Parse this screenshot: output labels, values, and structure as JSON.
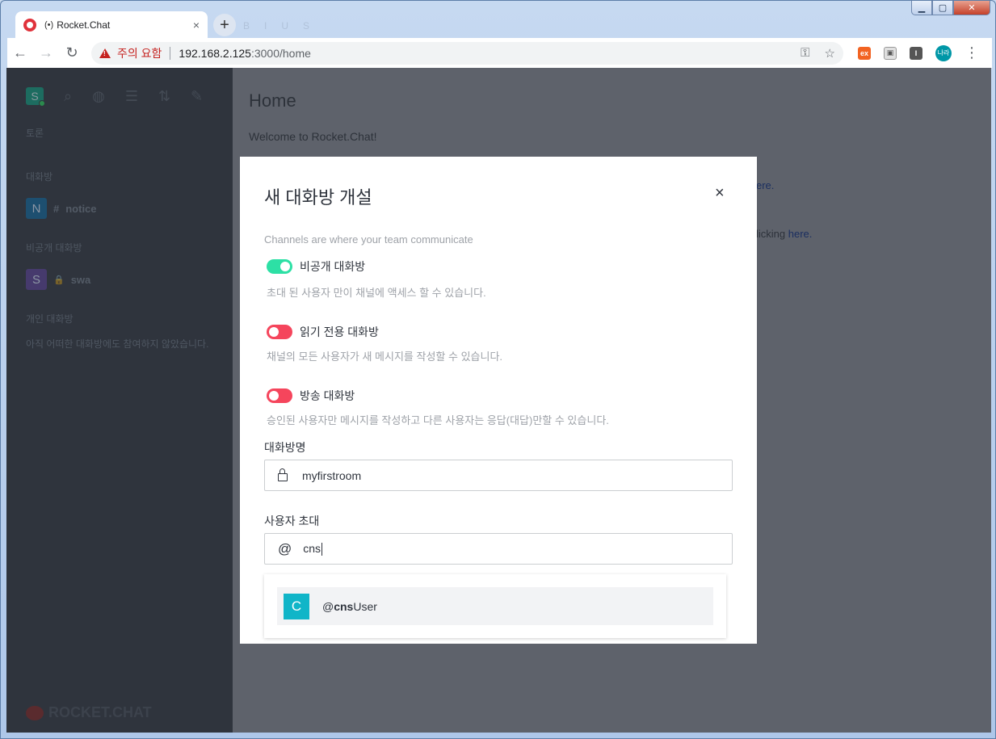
{
  "browser": {
    "tab_title": "Rocket.Chat",
    "tab_audio": "(•)",
    "tab_close": "×",
    "new_tab": "+",
    "security_warning": "주의 요함",
    "url_host": "192.168.2.125",
    "url_path": ":3000/home",
    "profile_initials": "나라",
    "ext_labels": [
      "ex",
      "▣",
      "I"
    ]
  },
  "sidebar": {
    "user_initial": "S",
    "sections": {
      "discussion": "토론",
      "channels": "대화방",
      "private": "비공개 대화방",
      "direct": "개인 대화방"
    },
    "rooms": [
      {
        "initial": "N",
        "prefix": "#",
        "name": "notice",
        "color": "#1d74b0"
      },
      {
        "initial": "S",
        "prefix": "🔒",
        "name": "swa",
        "color": "#6e4dbf"
      }
    ],
    "direct_empty": "아직 어떠한 대화방에도 참여하지 않았습니다.",
    "logo": "ROCKET.CHAT"
  },
  "main": {
    "title": "Home",
    "welcome": "Welcome to Rocket.Chat!",
    "link1": "ere.",
    "link2_prefix": "licking ",
    "link2_link": "here."
  },
  "modal": {
    "title": "새 대화방 개설",
    "close": "×",
    "description": "Channels are where your team communicate",
    "toggles": [
      {
        "label": "비공개 대화방",
        "hint": "초대 된 사용자 만이 채널에 액세스 할 수 있습니다.",
        "on": true
      },
      {
        "label": "읽기 전용 대화방",
        "hint": "채널의 모든 사용자가 새 메시지를 작성할 수 있습니다.",
        "on": false
      },
      {
        "label": "방송 대화방",
        "hint": "승인된 사용자만 메시지를 작성하고 다른 사용자는 응답(대답)만할 수 있습니다.",
        "on": false
      }
    ],
    "name_label": "대화방명",
    "name_value": "myfirstroom",
    "invite_label": "사용자 초대",
    "invite_at": "@",
    "invite_value": "cns",
    "suggestion": {
      "initial": "C",
      "prefix": "@",
      "match": "cns",
      "rest": "User"
    }
  },
  "colors": {
    "toggle_on": "#2de0a5",
    "toggle_off": "#f5455c",
    "suggestion_avatar": "#10b5c8"
  }
}
